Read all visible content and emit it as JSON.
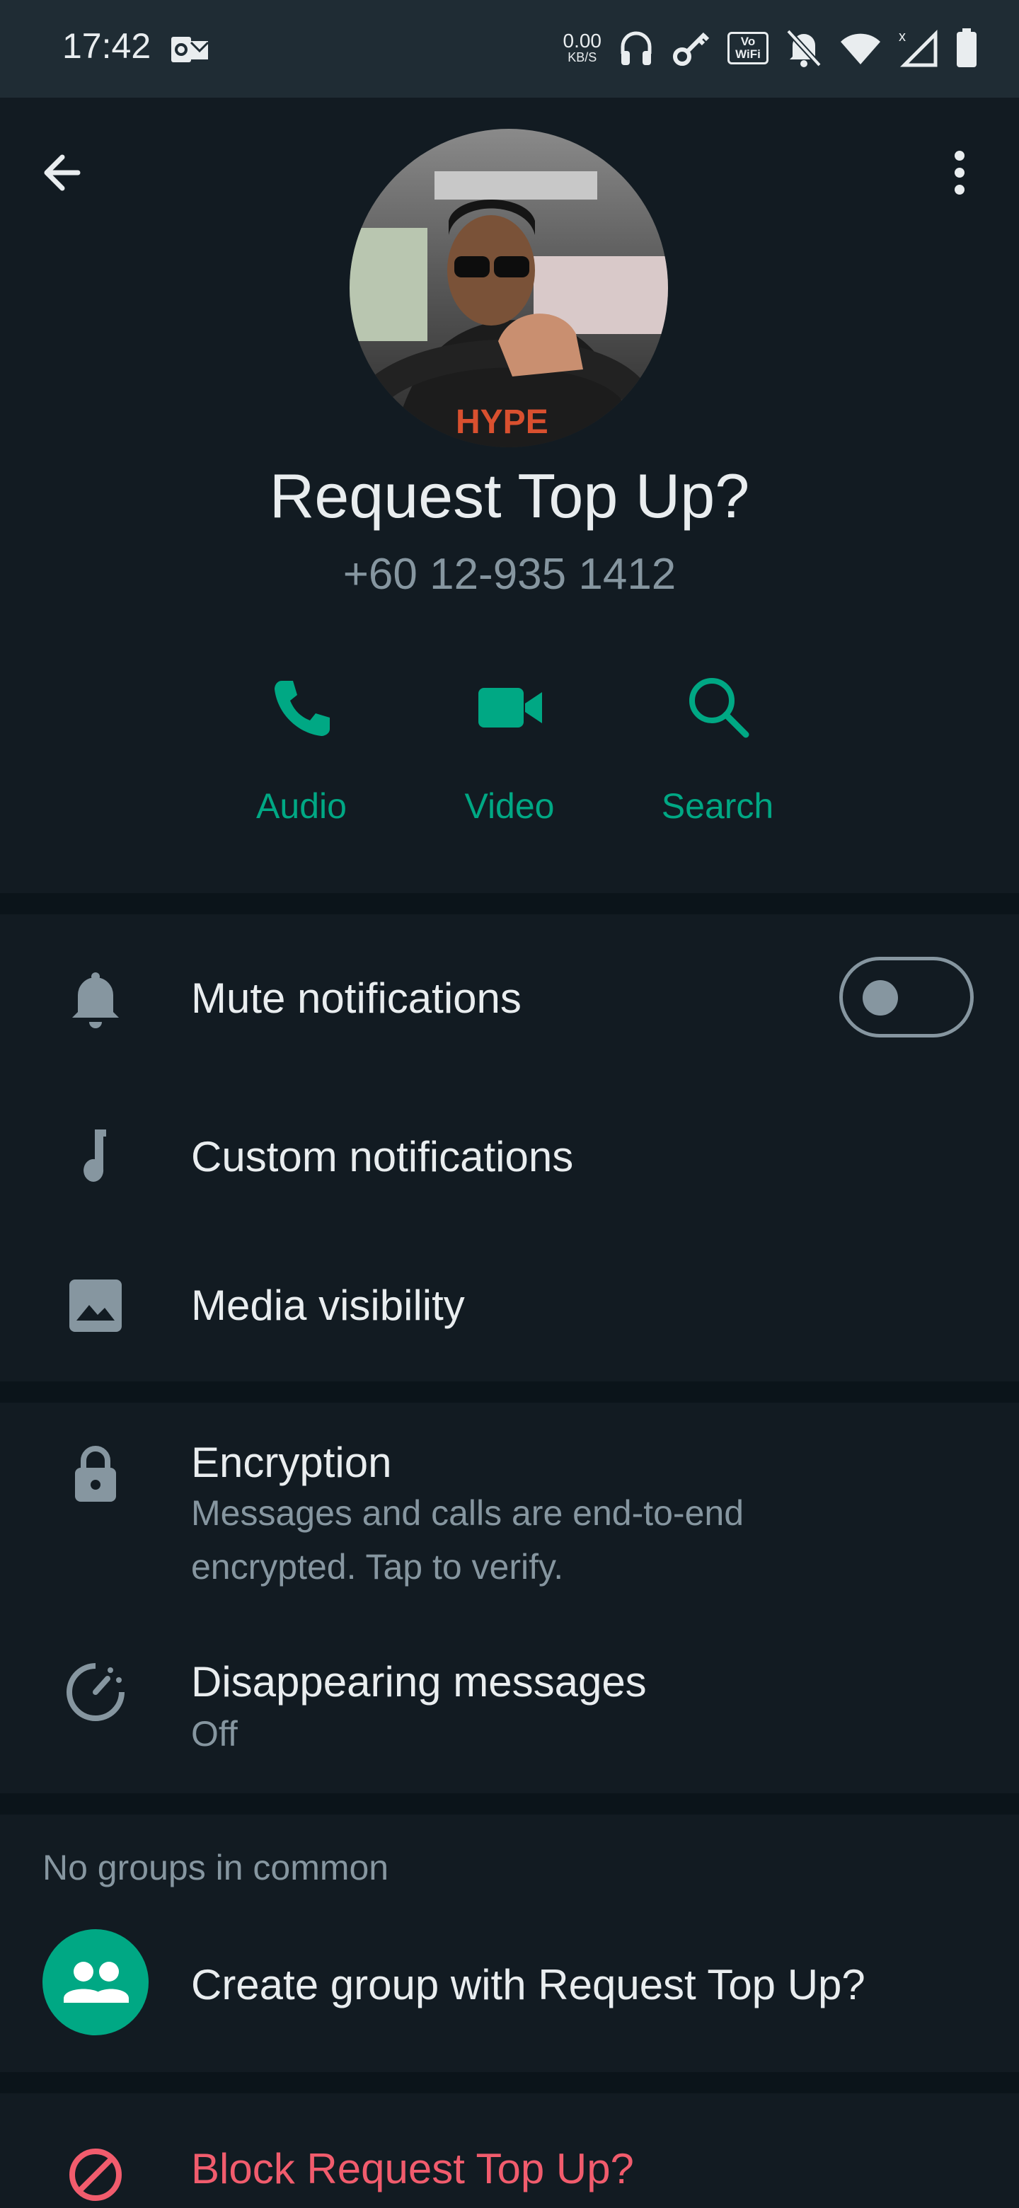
{
  "status_bar": {
    "time": "17:42",
    "net_speed": "0.00",
    "net_speed_unit": "KB/S",
    "vowifi_label": "Vo WiFi",
    "icons": [
      "outlook-icon",
      "headphones-icon",
      "key-icon",
      "vowifi-icon",
      "bell-off-icon",
      "wifi-icon",
      "signal-icon",
      "battery-icon"
    ]
  },
  "contact": {
    "name": "Request Top Up?",
    "phone": "+60 12-935 1412"
  },
  "actions": [
    {
      "label": "Audio",
      "icon": "phone-icon"
    },
    {
      "label": "Video",
      "icon": "video-icon"
    },
    {
      "label": "Search",
      "icon": "search-icon"
    }
  ],
  "settings": {
    "mute": {
      "label": "Mute notifications",
      "enabled": false
    },
    "custom": {
      "label": "Custom notifications"
    },
    "media": {
      "label": "Media visibility"
    }
  },
  "privacy": {
    "encryption": {
      "title": "Encryption",
      "subtitle_line1": "Messages and calls are end-to-end",
      "subtitle_line2": "encrypted. Tap to verify."
    },
    "disappearing": {
      "title": "Disappearing messages",
      "subtitle": "Off"
    }
  },
  "groups": {
    "header": "No groups in common",
    "create_label": "Create group with Request Top Up?"
  },
  "block": {
    "label": "Block Request Top Up?"
  },
  "colors": {
    "accent": "#00a884",
    "danger": "#f15c6d",
    "background": "#121b22",
    "secondary_text": "#8696a0"
  }
}
